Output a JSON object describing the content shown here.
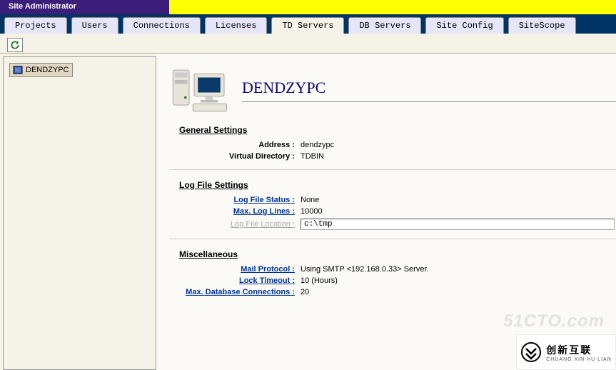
{
  "header": {
    "title": "Site Administrator"
  },
  "tabs": [
    {
      "label": "Projects"
    },
    {
      "label": "Users"
    },
    {
      "label": "Connections"
    },
    {
      "label": "Licenses"
    },
    {
      "label": "TD Servers",
      "active": true
    },
    {
      "label": "DB Servers"
    },
    {
      "label": "Site Config"
    },
    {
      "label": "SiteScope"
    }
  ],
  "sidebar": {
    "node": "DENDZYPC"
  },
  "page": {
    "server_name": "DENDZYPC"
  },
  "sections": {
    "general": {
      "title": "General Settings",
      "address_label": "Address :",
      "address_value": "dendzypc",
      "vdir_label": "Virtual Directory :",
      "vdir_value": "TDBIN"
    },
    "log": {
      "title": "Log File Settings",
      "status_label": "Log File Status :",
      "status_value": "None",
      "max_label": "Max. Log Lines :",
      "max_value": "10000",
      "loc_label": "Log File Location :",
      "loc_value": "c:\\tmp"
    },
    "misc": {
      "title": "Miscellaneous",
      "mail_label": "Mail Protocol :",
      "mail_value": "Using SMTP <192.168.0.33> Server.",
      "lock_label": "Lock Timeout :",
      "lock_value": "10 (Hours)",
      "db_label": "Max. Database Connections :",
      "db_value": "20"
    }
  },
  "watermark": "51CTO.com",
  "badge": {
    "cn": "创新互联",
    "py": "CHUANG XIN HU LIAN"
  }
}
